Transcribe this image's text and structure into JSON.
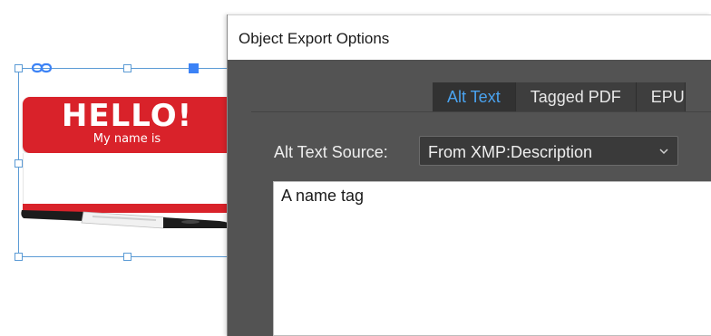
{
  "graphic": {
    "headline": "HELLO!",
    "subline": "My name is"
  },
  "dialog": {
    "title": "Object Export Options",
    "tabs": [
      {
        "label": "Alt Text",
        "active": true
      },
      {
        "label": "Tagged PDF",
        "active": false
      },
      {
        "label": "EPU",
        "active": false
      }
    ],
    "alt_text_source": {
      "label": "Alt Text Source:",
      "selected": "From XMP:Description"
    },
    "alt_text_value": "A name tag"
  },
  "colors": {
    "accent": "#4aa3f0",
    "tag_red": "#d9222a",
    "dialog_bg": "#535353",
    "selection_blue": "#5b9bd5"
  },
  "icons": [
    "link-icon",
    "chevron-down-icon"
  ]
}
